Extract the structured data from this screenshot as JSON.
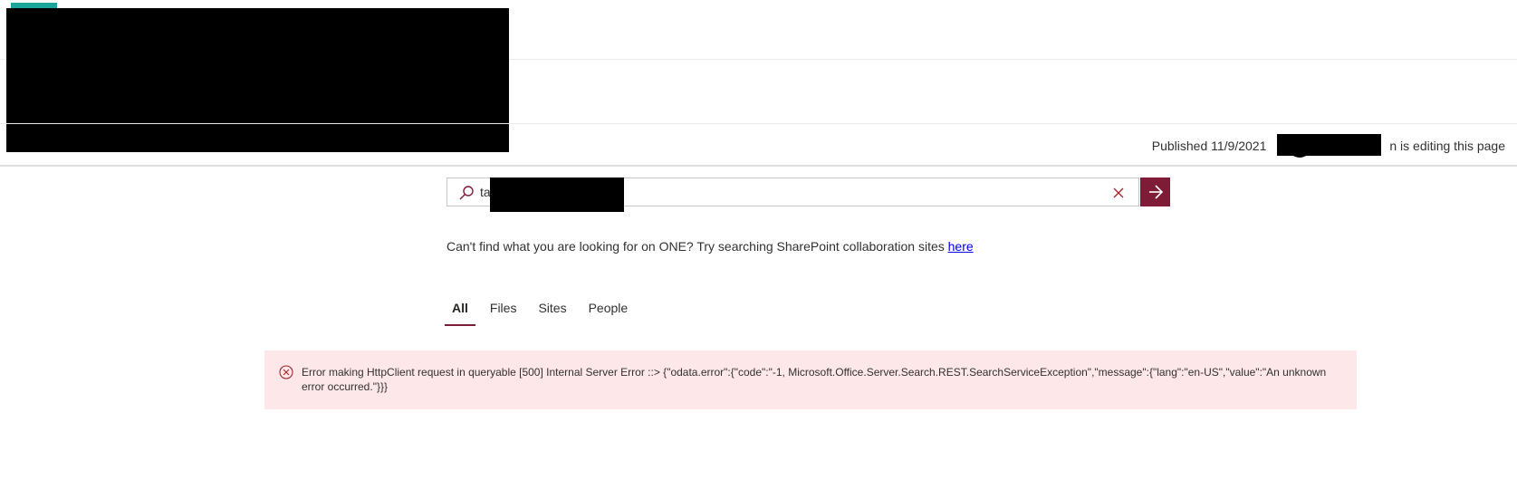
{
  "header": {
    "brand_color": "#1aa69a"
  },
  "page_status": {
    "published": "Published 11/9/2021",
    "editing_suffix": "n is editing this page"
  },
  "search": {
    "value": "ta",
    "icon": "search-icon",
    "clear_icon": "close-icon",
    "submit_icon": "arrow-right-icon",
    "accent_color": "#7e1b36"
  },
  "help": {
    "text": "Can't find what you are looking for on ONE? Try searching SharePoint collaboration sites ",
    "link_text": "here"
  },
  "tabs": [
    {
      "label": "All",
      "active": true
    },
    {
      "label": "Files",
      "active": false
    },
    {
      "label": "Sites",
      "active": false
    },
    {
      "label": "People",
      "active": false
    }
  ],
  "error": {
    "icon": "error-circle-icon",
    "message": "Error making HttpClient request in queryable [500] Internal Server Error ::> {\"odata.error\":{\"code\":\"-1, Microsoft.Office.Server.Search.REST.SearchServiceException\",\"message\":{\"lang\":\"en-US\",\"value\":\"An unknown error occurred.\"}}}",
    "background": "#fde7e9"
  }
}
